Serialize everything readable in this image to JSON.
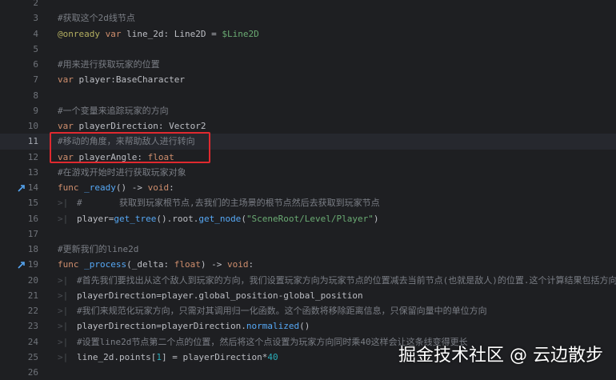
{
  "colors": {
    "background": "#1e1f22",
    "comment": "#7a7e85",
    "keyword": "#cf8e6d",
    "annotation": "#b3ae60",
    "string": "#6aab73",
    "function": "#56a8f5",
    "number": "#2aacb8",
    "highlight_box": "#e0292f"
  },
  "lines": [
    {
      "n": "2",
      "parts": []
    },
    {
      "n": "3",
      "parts": [
        {
          "t": "#获取这个2d线节点",
          "c": "c"
        }
      ]
    },
    {
      "n": "4",
      "parts": [
        {
          "t": "@onready",
          "c": "ann"
        },
        {
          "t": " var ",
          "c": "kw"
        },
        {
          "t": "line_2d: Line2D = "
        },
        {
          "t": "$Line2D",
          "c": "str"
        }
      ]
    },
    {
      "n": "5",
      "parts": []
    },
    {
      "n": "6",
      "parts": [
        {
          "t": "#用来进行获取玩家的位置",
          "c": "c"
        }
      ]
    },
    {
      "n": "7",
      "parts": [
        {
          "t": "var ",
          "c": "kw"
        },
        {
          "t": "player:BaseCharacter"
        }
      ]
    },
    {
      "n": "8",
      "parts": []
    },
    {
      "n": "9",
      "parts": [
        {
          "t": "#一个变量来追踪玩家的方向",
          "c": "c"
        }
      ]
    },
    {
      "n": "10",
      "parts": [
        {
          "t": "var ",
          "c": "kw"
        },
        {
          "t": "playerDirection: Vector2"
        }
      ]
    },
    {
      "n": "11",
      "hl": true,
      "parts": [
        {
          "t": "#移动的角度，来帮助敌人进行转向",
          "c": "c"
        }
      ]
    },
    {
      "n": "12",
      "parts": [
        {
          "t": "var ",
          "c": "kw"
        },
        {
          "t": "playerAngle: "
        },
        {
          "t": "float",
          "c": "kw"
        }
      ]
    },
    {
      "n": "13",
      "parts": [
        {
          "t": "#在游戏开始时进行获取玩家对象",
          "c": "c"
        }
      ]
    },
    {
      "n": "14",
      "icon": true,
      "parts": [
        {
          "t": "func ",
          "c": "kw"
        },
        {
          "t": "_ready",
          "c": "fn"
        },
        {
          "t": "() -> "
        },
        {
          "t": "void",
          "c": "kw"
        },
        {
          "t": ":"
        }
      ]
    },
    {
      "n": "15",
      "indent": 1,
      "parts": [
        {
          "t": "#\t",
          "c": "c"
        },
        {
          "t": "获取到玩家根节点,去我们的主场景的根节点然后去获取到玩家节点",
          "c": "c"
        }
      ]
    },
    {
      "n": "16",
      "indent": 1,
      "parts": [
        {
          "t": "player="
        },
        {
          "t": "get_tree",
          "c": "fn"
        },
        {
          "t": "().root."
        },
        {
          "t": "get_node",
          "c": "fn"
        },
        {
          "t": "("
        },
        {
          "t": "\"SceneRoot/Level/Player\"",
          "c": "str"
        },
        {
          "t": ")"
        }
      ]
    },
    {
      "n": "17",
      "parts": []
    },
    {
      "n": "18",
      "parts": [
        {
          "t": "#更新我们的line2d",
          "c": "c"
        }
      ]
    },
    {
      "n": "19",
      "icon": true,
      "parts": [
        {
          "t": "func ",
          "c": "kw"
        },
        {
          "t": "_process",
          "c": "fn"
        },
        {
          "t": "(_delta: "
        },
        {
          "t": "float",
          "c": "kw"
        },
        {
          "t": ") -> "
        },
        {
          "t": "void",
          "c": "kw"
        },
        {
          "t": ":"
        }
      ]
    },
    {
      "n": "20",
      "indent": 1,
      "parts": [
        {
          "t": "#首先我们要找出从这个敌人到玩家的方向，我们设置玩家方向为玩家节点的位置减去当前节点(也就是敌人)的位置.这个计算结果包括方向和距离",
          "c": "c"
        }
      ]
    },
    {
      "n": "21",
      "indent": 1,
      "parts": [
        {
          "t": "playerDirection=player.global_position-global_position"
        }
      ]
    },
    {
      "n": "22",
      "indent": 1,
      "parts": [
        {
          "t": "#我们来规范化玩家方向，只需对其调用归一化函数。这个函数将移除距离信息，只保留向量中的单位方向",
          "c": "c"
        }
      ]
    },
    {
      "n": "23",
      "indent": 1,
      "parts": [
        {
          "t": "playerDirection=playerDirection."
        },
        {
          "t": "normalized",
          "c": "fn"
        },
        {
          "t": "()"
        }
      ]
    },
    {
      "n": "24",
      "indent": 1,
      "parts": [
        {
          "t": "#设置line2d节点第二个点的位置，然后将这个点设置为玩家方向同时乘40这样会让这条线变得更长",
          "c": "c"
        }
      ]
    },
    {
      "n": "25",
      "indent": 1,
      "parts": [
        {
          "t": "line_2d.points["
        },
        {
          "t": "1",
          "c": "num-lit"
        },
        {
          "t": "] = playerDirection*"
        },
        {
          "t": "40",
          "c": "num-lit"
        }
      ]
    },
    {
      "n": "26",
      "parts": []
    }
  ],
  "watermark": "掘金技术社区 @ 云边散步"
}
